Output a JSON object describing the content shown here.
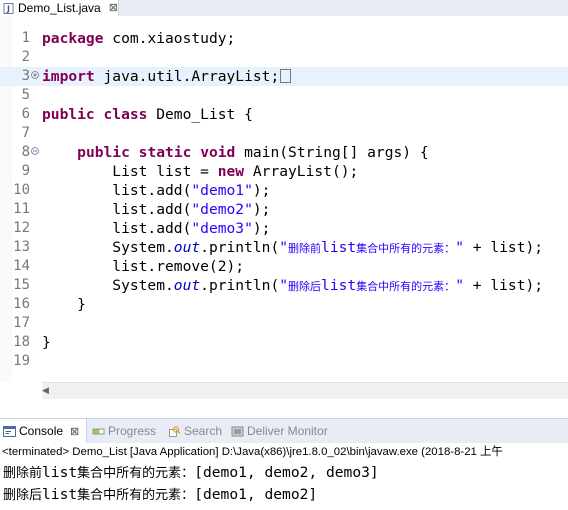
{
  "editor": {
    "tab_title": "Demo_List.java",
    "tab_close": "⊠"
  },
  "code": {
    "lines": [
      {
        "num": "1"
      },
      {
        "num": "2"
      },
      {
        "num": "3"
      },
      {
        "num": "5"
      },
      {
        "num": "6"
      },
      {
        "num": "7"
      },
      {
        "num": "8"
      },
      {
        "num": "9"
      },
      {
        "num": "10"
      },
      {
        "num": "11"
      },
      {
        "num": "12"
      },
      {
        "num": "13"
      },
      {
        "num": "14"
      },
      {
        "num": "15"
      },
      {
        "num": "16"
      },
      {
        "num": "17"
      },
      {
        "num": "18"
      },
      {
        "num": "19"
      }
    ],
    "l1_kw": "package",
    "l1_rest": " com.xiaostudy;",
    "l3_kw": "import",
    "l3_rest": " java.util.ArrayList;",
    "l6_kw1": "public",
    "l6_kw2": "class",
    "l6_rest": " Demo_List {",
    "l8_indent": "    ",
    "l8_kw1": "public",
    "l8_kw2": "static",
    "l8_kw3": "void",
    "l8_rest": " main(String[] args) {",
    "l9_a": "        List list = ",
    "l9_kw": "new",
    "l9_b": " ArrayList();",
    "l10_a": "        list.add(",
    "l10_str": "\"demo1\"",
    "l10_b": ");",
    "l11_a": "        list.add(",
    "l11_str": "\"demo2\"",
    "l11_b": ");",
    "l12_a": "        list.add(",
    "l12_str": "\"demo3\"",
    "l12_b": ");",
    "l13_a": "        System.",
    "l13_out": "out",
    "l13_b": ".println(",
    "l13_str_q1": "\"",
    "l13_str_cjk1": "删除前",
    "l13_str_mid": "list",
    "l13_str_cjk2": "集合中所有的元素：",
    "l13_str_q2": "\"",
    "l13_c": " + list);",
    "l14_a": "        list.remove(2);",
    "l15_a": "        System.",
    "l15_out": "out",
    "l15_b": ".println(",
    "l15_str_q1": "\"",
    "l15_str_cjk1": "删除后",
    "l15_str_mid": "list",
    "l15_str_cjk2": "集合中所有的元素：",
    "l15_str_q2": "\"",
    "l15_c": " + list);",
    "l16_a": "    }",
    "l18_a": "}"
  },
  "views": {
    "console_label": "Console",
    "progress_label": "Progress",
    "search_label": "Search",
    "deliver_label": "Deliver Monitor",
    "close_glyph": "⊠"
  },
  "console": {
    "status": "<terminated> Demo_List [Java Application] D:\\Java(x86)\\jre1.8.0_02\\bin\\javaw.exe (2018-8-21 上午",
    "out1_cjk": "删除前",
    "out1_mid": "list",
    "out1_cjk2": "集合中所有的元素：",
    "out1_val": "[demo1, demo2, demo3]",
    "out2_cjk": "删除后",
    "out2_mid": "list",
    "out2_cjk2": "集合中所有的元素：",
    "out2_val": "[demo1, demo2]"
  },
  "colors": {
    "keyword": "#7f0055",
    "string": "#2a00ff",
    "static_field": "#0000c0",
    "line_number": "#787878"
  }
}
